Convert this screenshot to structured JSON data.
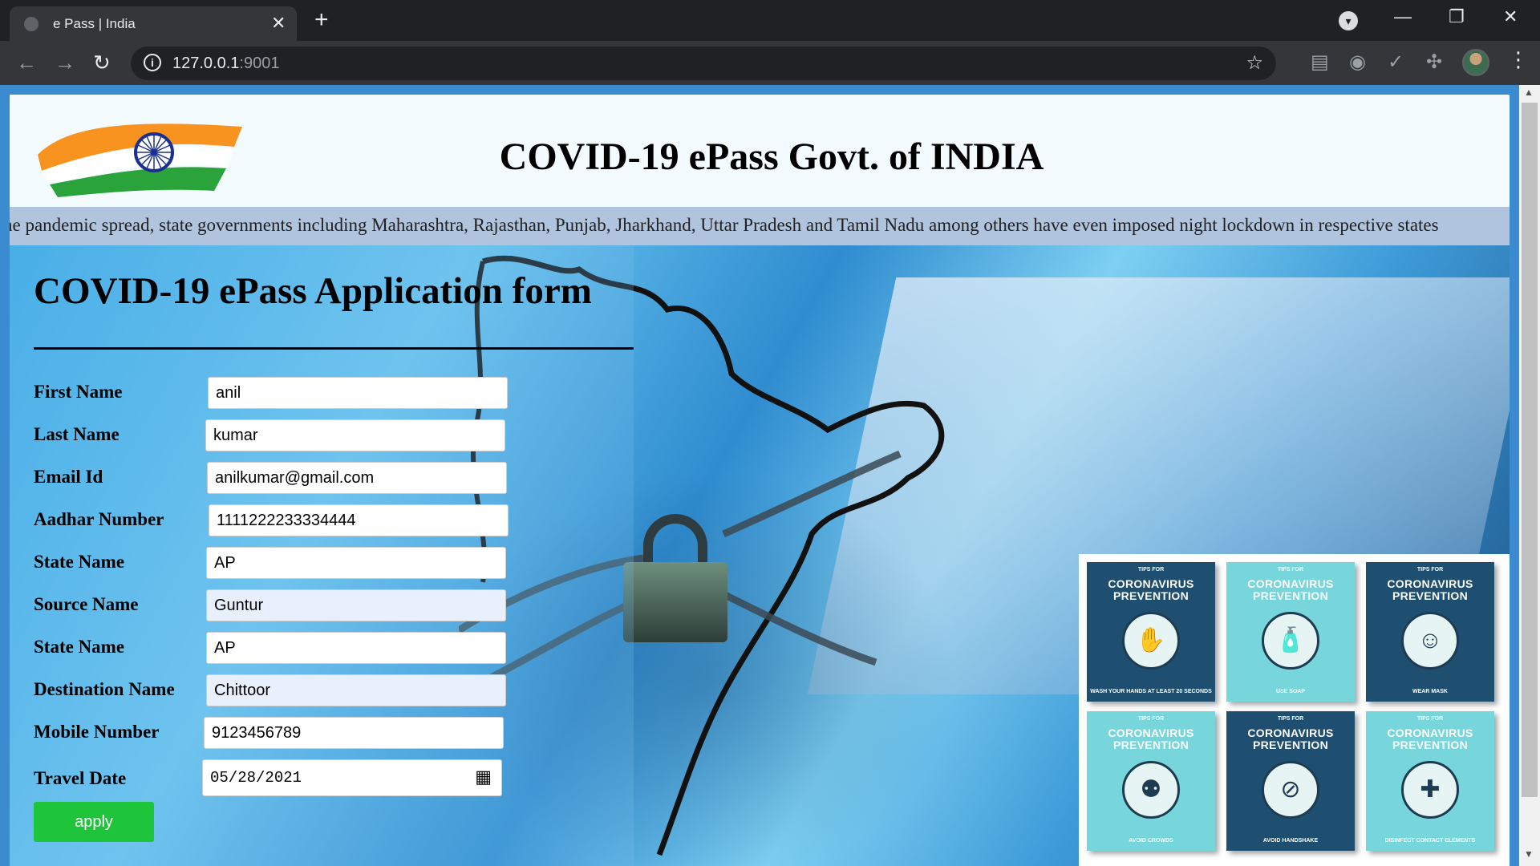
{
  "browser": {
    "tab_title": "e Pass | India",
    "tab_close": "✕",
    "new_tab": "+",
    "back": "←",
    "forward": "→",
    "reload": "↻",
    "url_host": "127.0.0.1",
    "url_port": ":9001",
    "info_icon": "i",
    "star": "☆",
    "minimize": "—",
    "restore": "❐",
    "close": "✕",
    "profile_dropdown": "▾",
    "menu": "⋮"
  },
  "header": {
    "title": "COVID-19 ePass Govt. of INDIA"
  },
  "marquee": {
    "text": "he pandemic spread, state governments including Maharashtra, Rajasthan, Punjab, Jharkhand, Uttar Pradesh and Tamil Nadu among others have even imposed night lockdown in respective states"
  },
  "form": {
    "title": "COVID-19 ePass Application form",
    "fields": [
      {
        "label": "First Name",
        "value": "anil"
      },
      {
        "label": "Last Name",
        "value": "kumar"
      },
      {
        "label": "Email Id",
        "value": "anilkumar@gmail.com"
      },
      {
        "label": "Aadhar Number",
        "value": "1111222233334444"
      },
      {
        "label": "State Name",
        "value": "AP"
      },
      {
        "label": "Source Name",
        "value": "Guntur"
      },
      {
        "label": "State Name",
        "value": "AP"
      },
      {
        "label": "Destination Name",
        "value": "Chittoor"
      },
      {
        "label": "Mobile Number",
        "value": "9123456789"
      },
      {
        "label": "Travel Date",
        "value": "05/28/2021"
      }
    ],
    "submit_label": "apply"
  },
  "tips": {
    "cards": [
      {
        "tips_for": "TIPS FOR",
        "heading": "CORONAVIRUS PREVENTION",
        "caption": "WASH YOUR HANDS AT LEAST 20 SECONDS",
        "icon": "hand-wash-icon",
        "glyph": "✋",
        "style": "dark"
      },
      {
        "tips_for": "TIPS FOR",
        "heading": "CORONAVIRUS PREVENTION",
        "caption": "USE SOAP",
        "icon": "soap-icon",
        "glyph": "🧴",
        "style": "light"
      },
      {
        "tips_for": "TIPS FOR",
        "heading": "CORONAVIRUS PREVENTION",
        "caption": "WEAR MASK",
        "icon": "mask-icon",
        "glyph": "☺",
        "style": "dark"
      },
      {
        "tips_for": "TIPS FOR",
        "heading": "CORONAVIRUS PREVENTION",
        "caption": "AVOID CROWDS",
        "icon": "crowd-icon",
        "glyph": "⚉",
        "style": "light"
      },
      {
        "tips_for": "TIPS FOR",
        "heading": "CORONAVIRUS PREVENTION",
        "caption": "AVOID HANDSHAKE",
        "icon": "handshake-icon",
        "glyph": "⊘",
        "style": "dark"
      },
      {
        "tips_for": "TIPS FOR",
        "heading": "CORONAVIRUS PREVENTION",
        "caption": "DISINFECT CONTACT ELEMENTS",
        "icon": "spray-icon",
        "glyph": "✚",
        "style": "light"
      }
    ]
  },
  "colors": {
    "apply_button": "#1ec43a",
    "header_bg": "#f4fbff",
    "marquee_bg": "#b0c4de",
    "card_dark": "#1e4e70",
    "card_light": "#76d6dc"
  }
}
